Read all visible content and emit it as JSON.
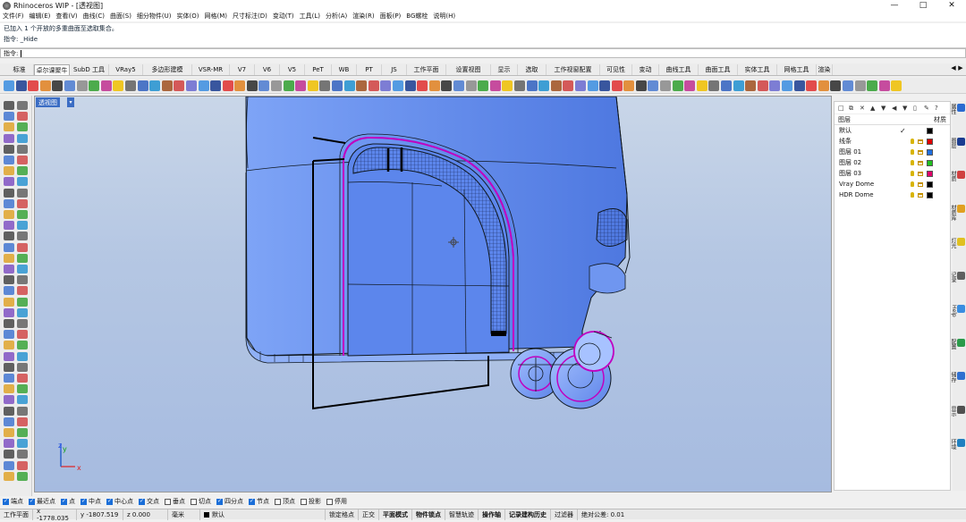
{
  "window": {
    "title": "Rhinoceros WIP - [透视图]",
    "controls": [
      "—",
      "□",
      "✕"
    ]
  },
  "menu": {
    "items": [
      "文件(F)",
      "编辑(E)",
      "查看(V)",
      "曲线(C)",
      "曲面(S)",
      "细分物件(U)",
      "实体(O)",
      "网格(M)",
      "尺寸标注(D)",
      "变动(T)",
      "工具(L)",
      "分析(A)",
      "渲染(R)",
      "面板(P)",
      "BG螺栓",
      "说明(H)"
    ]
  },
  "command": {
    "history": [
      "已加入 1 个开放的多重曲面至选取集合。",
      "指令: _Hide"
    ],
    "prompt_label": "指令:"
  },
  "toolbar_tabs": {
    "items": [
      "标准",
      "卓尔课聚牛",
      "SubD 工具",
      "VRay5",
      "多边形建模",
      "VSR-MR",
      "V7",
      "V6",
      "V5",
      "PeT",
      "WB",
      "PT",
      "JS",
      "工作平面",
      "设置视图",
      "显示",
      "选取",
      "工作视窗配置",
      "可见性",
      "变动",
      "曲线工具",
      "曲面工具",
      "实体工具",
      "网格工具",
      "渲染"
    ],
    "active_index": 1,
    "arrow_left": "◀",
    "arrow_right": "▶"
  },
  "viewport": {
    "label": "透视图",
    "dropdown_icon": "chevron-down-icon",
    "dropdown_glyph": "▾",
    "axis_x": "x",
    "axis_y": "y",
    "axis_z": "z",
    "background_top": "#c9d6e8",
    "background_bottom": "#a6bbe0",
    "model_color": "#6f96f0",
    "edge_color": "#c000c0"
  },
  "layers_panel": {
    "header_name": "图层",
    "header_material": "材质",
    "icons": [
      "new-layer-icon",
      "new-sublayer-icon",
      "delete-icon",
      "move-up-icon",
      "move-down-icon",
      "move-left-icon",
      "filter-icon",
      "settings-icon",
      "tools-icon",
      "help-icon"
    ],
    "icon_glyphs": [
      "□",
      "⧉",
      "✕",
      "▲",
      "▼",
      "◀",
      "▼",
      "▯",
      "✎",
      "?"
    ],
    "current_check": "✓",
    "rows": [
      {
        "name": "默认",
        "current": true,
        "color": "#000000",
        "show_icons": false
      },
      {
        "name": "线条",
        "current": false,
        "color": "#e00000",
        "show_icons": true
      },
      {
        "name": "图层 01",
        "current": false,
        "color": "#1f6fe0",
        "show_icons": true
      },
      {
        "name": "图层 02",
        "current": false,
        "color": "#20c020",
        "show_icons": true
      },
      {
        "name": "图层 03",
        "current": false,
        "color": "#e0006a",
        "show_icons": true
      },
      {
        "name": "Vray Dome",
        "current": false,
        "color": "#000000",
        "show_icons": true
      },
      {
        "name": "HDR Dome",
        "current": false,
        "color": "#000000",
        "show_icons": true
      }
    ]
  },
  "side_tabs": [
    "属性",
    "图层",
    "材质",
    "材质库",
    "灯光",
    "记录",
    "Help",
    "配置",
    "储存",
    "显示",
    "环境"
  ],
  "osnap": [
    {
      "label": "端点",
      "on": true
    },
    {
      "label": "最近点",
      "on": true
    },
    {
      "label": "点",
      "on": true
    },
    {
      "label": "中点",
      "on": true
    },
    {
      "label": "中心点",
      "on": true
    },
    {
      "label": "交点",
      "on": true
    },
    {
      "label": "垂点",
      "on": false
    },
    {
      "label": "切点",
      "on": false
    },
    {
      "label": "四分点",
      "on": true
    },
    {
      "label": "节点",
      "on": true
    },
    {
      "label": "顶点",
      "on": false
    },
    {
      "label": "投影",
      "on": false
    },
    {
      "label": "停用",
      "on": false
    }
  ],
  "checkmark_glyph": "✓",
  "status": {
    "plane": "工作平面",
    "x": "x -1778.035",
    "y": "y -1807.519",
    "z": "z 0.000",
    "units": "毫米",
    "layer": "默认",
    "layer_color": "#000000",
    "toggles": [
      {
        "label": "锁定格点",
        "bold": false
      },
      {
        "label": "正交",
        "bold": false
      },
      {
        "label": "平面模式",
        "bold": true
      },
      {
        "label": "物件锁点",
        "bold": true
      },
      {
        "label": "智慧轨迹",
        "bold": false
      },
      {
        "label": "操作轴",
        "bold": true
      },
      {
        "label": "记录建构历史",
        "bold": true
      },
      {
        "label": "过滤器",
        "bold": false
      }
    ],
    "tolerance": "绝对公差: 0.01"
  }
}
